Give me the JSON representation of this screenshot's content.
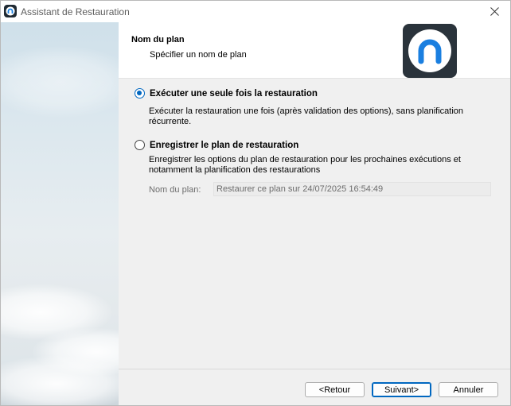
{
  "window": {
    "title": "Assistant de Restauration"
  },
  "header": {
    "title": "Nom du plan",
    "subtitle": "Spécifier un nom de plan"
  },
  "options": [
    {
      "label": "Exécuter une seule fois la restauration",
      "description": "Exécuter la restauration une fois (après validation des options), sans planification récurrente.",
      "checked": true
    },
    {
      "label": "Enregistrer le plan de restauration",
      "description": "Enregistrer les options du plan de restauration pour les prochaines exécutions et notamment la planification des restaurations",
      "checked": false
    }
  ],
  "plan_name": {
    "label": "Nom du plan:",
    "value": "Restaurer ce plan sur 24/07/2025 16:54:49"
  },
  "buttons": {
    "back": "<Retour",
    "next": "Suivant>",
    "cancel": "Annuler"
  },
  "colors": {
    "accent": "#0067c0",
    "logo_bg": "#2a333b",
    "logo_arc": "#1a7fe0"
  },
  "icons": {
    "close": "close-icon",
    "app": "app-logo-icon"
  }
}
